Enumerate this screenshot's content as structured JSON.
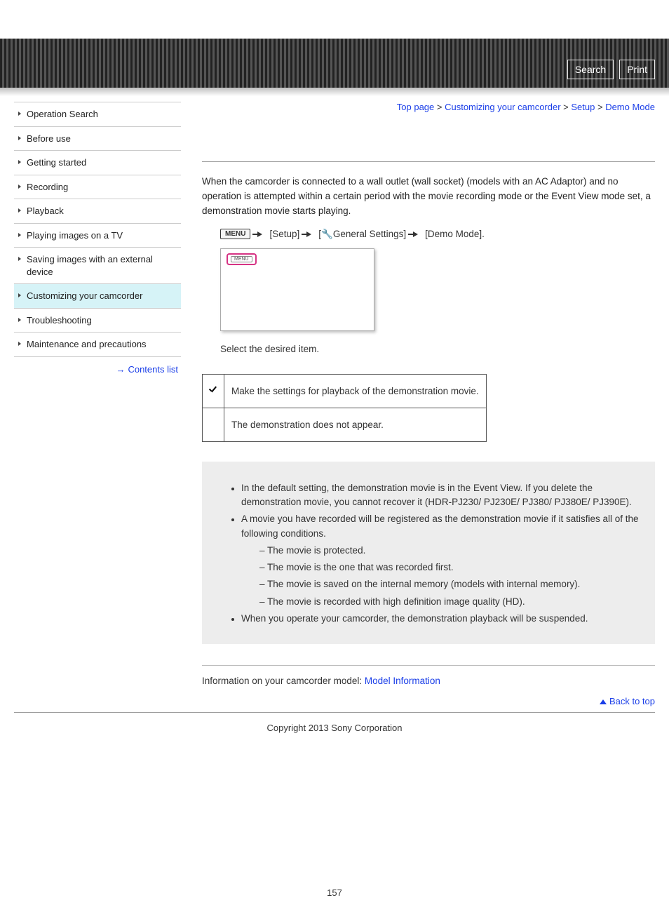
{
  "top_buttons": {
    "search": "Search",
    "print": "Print"
  },
  "breadcrumb": {
    "top": "Top page",
    "cust": "Customizing your camcorder",
    "setup": "Setup",
    "demo": "Demo Mode",
    "sep": " > "
  },
  "sidebar": {
    "items": [
      "Operation Search",
      "Before use",
      "Getting started",
      "Recording",
      "Playback",
      "Playing images on a TV",
      "Saving images with an external device",
      "Customizing your camcorder",
      "Troubleshooting",
      "Maintenance and precautions"
    ],
    "active_index": 7,
    "contents_link": "Contents list"
  },
  "content": {
    "intro": "When the camcorder is connected to a wall outlet (wall socket) (models with an AC Adaptor) and no operation is attempted within a certain period with the movie recording mode or the Event View mode set, a demonstration movie starts playing.",
    "menu_chip": "MENU",
    "path_setup": "[Setup]",
    "path_general": "General Settings]",
    "path_general_prefix": "[",
    "path_demo": "[Demo Mode].",
    "screen_chip": "MENU",
    "select_text": "Select the desired item.",
    "options": [
      {
        "icon": "check",
        "text": "Make the settings for playback of the demonstration movie."
      },
      {
        "icon": "",
        "text": "The demonstration does not appear."
      }
    ],
    "notes": [
      "In the default setting, the demonstration movie is in the Event View. If you delete the demonstration movie, you cannot recover it (HDR-PJ230/ PJ230E/ PJ380/ PJ380E/ PJ390E).",
      "A movie you have recorded will be registered as the demonstration movie if it satisfies all of the following conditions.",
      "When you operate your camcorder, the demonstration playback will be suspended."
    ],
    "subnotes": [
      "The movie is protected.",
      "The movie is the one that was recorded first.",
      "The movie is saved on the internal memory (models with internal memory).",
      "The movie is recorded with high definition image quality (HD)."
    ],
    "model_prefix": "Information on your camcorder model: ",
    "model_link": "Model Information",
    "back_to_top": "Back to top"
  },
  "footer": {
    "copyright": "Copyright 2013 Sony Corporation",
    "page": "157"
  }
}
